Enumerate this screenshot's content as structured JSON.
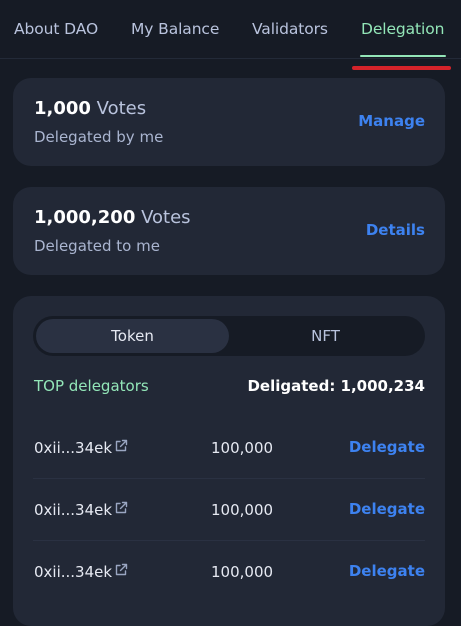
{
  "tabs": [
    {
      "label": "About DAO"
    },
    {
      "label": "My Balance"
    },
    {
      "label": "Validators"
    },
    {
      "label": "Delegation"
    }
  ],
  "active_tab": "Delegation",
  "colors": {
    "background": "#161b25",
    "card": "#222836",
    "accent_green": "#93e6b8",
    "link_blue": "#3d82f0",
    "annotation_red": "#d4232a"
  },
  "delegated_by_me": {
    "amount": "1,000",
    "unit": "Votes",
    "caption": "Delegated by me",
    "action": "Manage"
  },
  "delegated_to_me": {
    "amount": "1,000,200",
    "unit": "Votes",
    "caption": "Delegated to me",
    "action": "Details"
  },
  "toggle": {
    "options": [
      "Token",
      "NFT"
    ],
    "selected": "Token"
  },
  "delegators": {
    "title": "TOP delegators",
    "total_label": "Deligated: 1,000,234",
    "rows": [
      {
        "address": "0xii...34ek",
        "link_icon": "external-link-icon",
        "amount": "100,000",
        "action": "Delegate"
      },
      {
        "address": "0xii...34ek",
        "link_icon": "external-link-icon",
        "amount": "100,000",
        "action": "Delegate"
      },
      {
        "address": "0xii...34ek",
        "link_icon": "external-link-icon",
        "amount": "100,000",
        "action": "Delegate"
      }
    ]
  }
}
